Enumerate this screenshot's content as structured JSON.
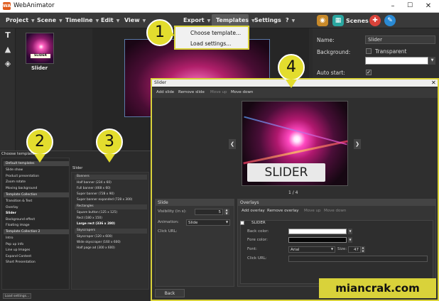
{
  "app": {
    "title": "WebAnimator",
    "logo_text": "WA"
  },
  "window_controls": {
    "minimize": "–",
    "maximize": "☐",
    "close": "✕"
  },
  "menu": {
    "items": [
      "Project",
      "Scene",
      "Timeline",
      "Edit",
      "View",
      "Export",
      "Templates",
      "Settings",
      "?"
    ],
    "scenes_label": "Scenes"
  },
  "templates_dropdown": {
    "items": [
      "Choose template...",
      "Load settings..."
    ]
  },
  "scene": {
    "label": "Slider",
    "thumb_tag": "SLIDER"
  },
  "properties": {
    "name_label": "Name:",
    "name_value": "Slider",
    "background_label": "Background:",
    "transparent_label": "Transparent",
    "autostart_label": "Auto start:"
  },
  "templates_panel": {
    "title": "Choose template",
    "list": [
      {
        "label": "Default templates",
        "group": true
      },
      {
        "label": "Slide show"
      },
      {
        "label": "Product presentation"
      },
      {
        "label": "Zoom rotate"
      },
      {
        "label": "Moving background"
      },
      {
        "label": "Template Collection",
        "group": true
      },
      {
        "label": "Transition & Text"
      },
      {
        "label": "Overlay"
      },
      {
        "label": "Slider",
        "selected": true
      },
      {
        "label": "Background effect"
      },
      {
        "label": "Floating image"
      },
      {
        "label": "Template Collection 2",
        "group": true
      },
      {
        "label": "Intro"
      },
      {
        "label": "Pop up info"
      },
      {
        "label": "Line up Images"
      },
      {
        "label": "Expand Content"
      },
      {
        "label": "Short Presentation"
      }
    ],
    "detail_title": "Slider",
    "detail": [
      {
        "label": "Banners",
        "group": true
      },
      {
        "label": "Half banner (234 x 60)"
      },
      {
        "label": "Full banner (468 x 60)"
      },
      {
        "label": "Super banner (728 x 90)"
      },
      {
        "label": "Super banner expanded (728 x 300)"
      },
      {
        "label": "Rectangles",
        "group": true
      },
      {
        "label": "Square button (125 x 125)"
      },
      {
        "label": "Rect (180 x 150)"
      },
      {
        "label": "Large rect (336 x 280)",
        "selected": true
      },
      {
        "label": "Skyscrapers",
        "group": true
      },
      {
        "label": "Skyscraper (120 x 600)"
      },
      {
        "label": "Wide skyscraper (160 x 600)"
      },
      {
        "label": "Half page ad (300 x 600)"
      }
    ],
    "load_settings_label": "Load settings..."
  },
  "callouts": [
    "1",
    "2",
    "3",
    "4"
  ],
  "dialog": {
    "title": "Slider",
    "close": "✕",
    "toolbar": {
      "add": "Add slide",
      "remove": "Remove slide",
      "move_up": "Move up",
      "move_down": "Move down"
    },
    "preview_label": "SLIDER",
    "prev_arrow": "❮",
    "next_arrow": "❯",
    "page_indicator": "1 / 4",
    "slide": {
      "header": "Slide",
      "visibility_label": "Visibility (in s):",
      "visibility_value": "5",
      "animation_label": "Animation:",
      "animation_value": "Slide",
      "clickurl_label": "Click URL:"
    },
    "overlays": {
      "header": "Overlays",
      "add": "Add overlay",
      "remove": "Remove overlay",
      "move_up": "Move up",
      "move_down": "Move down",
      "item_label": "SLIDER",
      "back_color_label": "Back color:",
      "fore_color_label": "Fore color:",
      "font_label": "Font:",
      "font_value": "Arial",
      "size_label": "Size:",
      "size_value": "47",
      "clickurl_label": "Click URL:"
    },
    "back_button": "Back"
  },
  "watermark": "miancrak.com",
  "colors": {
    "accent_yellow": "#d9d23a",
    "logo_orange": "#e05a1a",
    "scenes_teal": "#2aa6a0",
    "help_red": "#d9433a",
    "tool_blue": "#2a8ad4"
  }
}
